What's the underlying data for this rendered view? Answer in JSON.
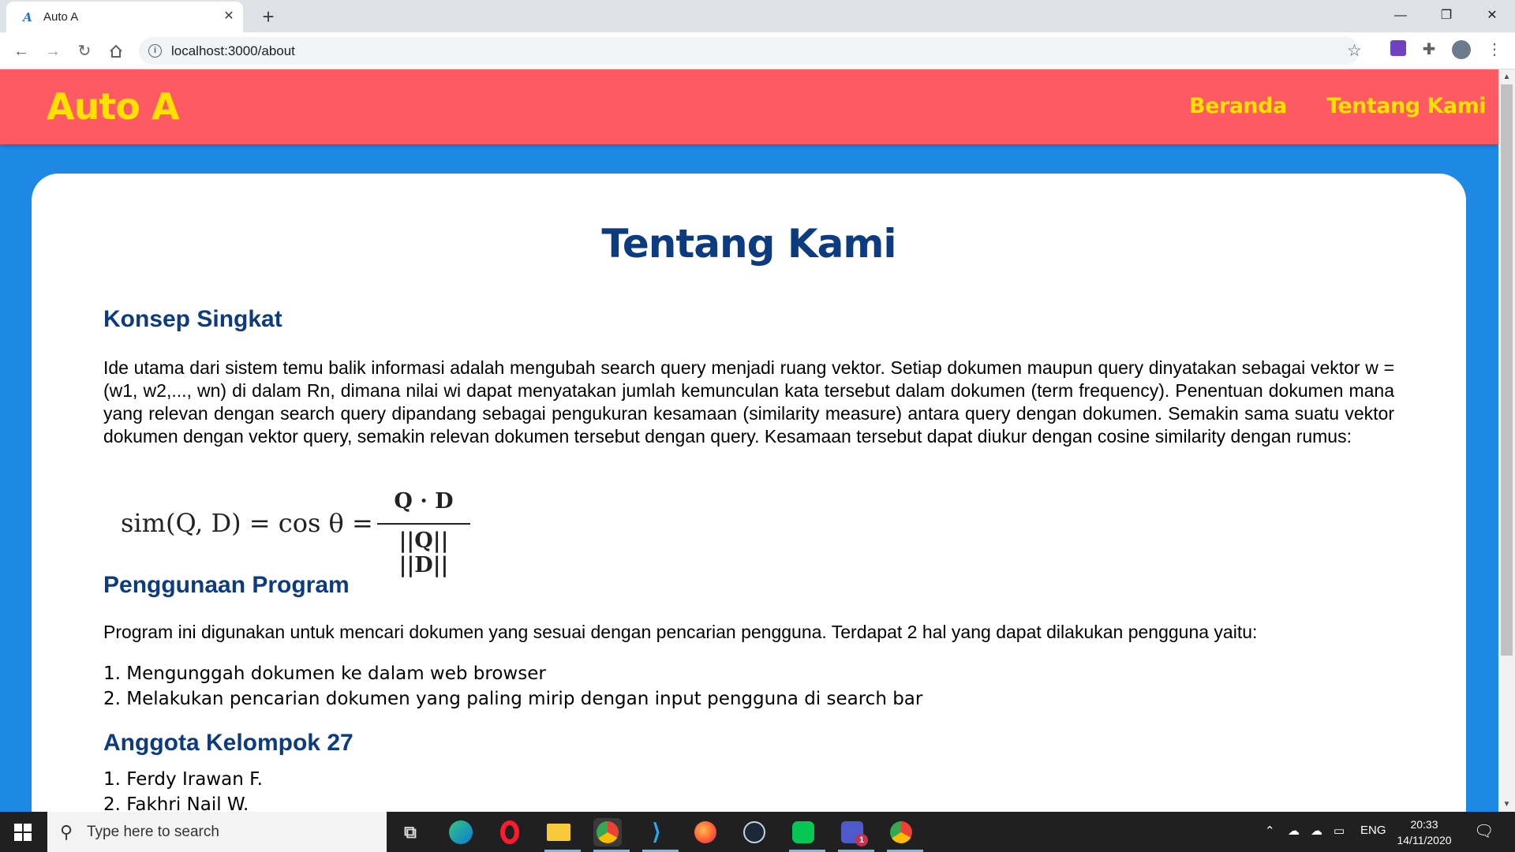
{
  "browser": {
    "tab_title": "Auto A",
    "tab_favicon": "A",
    "url": "localhost:3000/about"
  },
  "page": {
    "brand": "Auto A",
    "nav": [
      "Beranda",
      "Tentang Kami"
    ],
    "title": "Tentang Kami",
    "sections": [
      {
        "heading": "Konsep Singkat",
        "text": "Ide utama dari sistem temu balik informasi adalah mengubah search query menjadi ruang vektor. Setiap dokumen maupun query dinyatakan sebagai vektor w = (w1, w2,..., wn) di dalam Rn, dimana nilai wi dapat menyatakan jumlah kemunculan kata tersebut dalam dokumen (term frequency). Penentuan dokumen mana yang relevan dengan search query dipandang sebagai pengukuran kesamaan (similarity measure) antara query dengan dokumen. Semakin sama suatu vektor dokumen dengan vektor query, semakin relevan dokumen tersebut dengan query. Kesamaan tersebut dapat diukur dengan cosine similarity dengan rumus:"
      },
      {
        "heading": "Penggunaan Program",
        "text": "Program ini digunakan untuk mencari dokumen yang sesuai dengan pencarian pengguna. Terdapat 2 hal yang dapat dilakukan pengguna yaitu:",
        "items": [
          "1. Mengunggah dokumen ke dalam web browser",
          "2. Melakukan pencarian dokumen yang paling mirip dengan input pengguna di search bar"
        ]
      },
      {
        "heading": "Anggota Kelompok 27",
        "items": [
          "1. Ferdy Irawan F.",
          "2. Fakhri Nail W."
        ]
      }
    ],
    "formula": {
      "lhs": "sim(Q, D) =  cos θ =",
      "numerator": "Q · D",
      "denominator": "||Q|| ||D||"
    }
  },
  "taskbar": {
    "search_placeholder": "Type here to search",
    "language": "ENG",
    "time": "20:33",
    "date": "14/11/2020",
    "apps": [
      "task-view",
      "edge",
      "opera",
      "file-explorer",
      "chrome",
      "vscode",
      "firefox",
      "steam",
      "line",
      "teams",
      "chrome"
    ],
    "teams_badge": "1"
  },
  "colors": {
    "navbar": "#ff5a63",
    "brand_yellow": "#ffe100",
    "page_bg": "#1e88e5",
    "heading_blue": "#0d3b7f"
  }
}
